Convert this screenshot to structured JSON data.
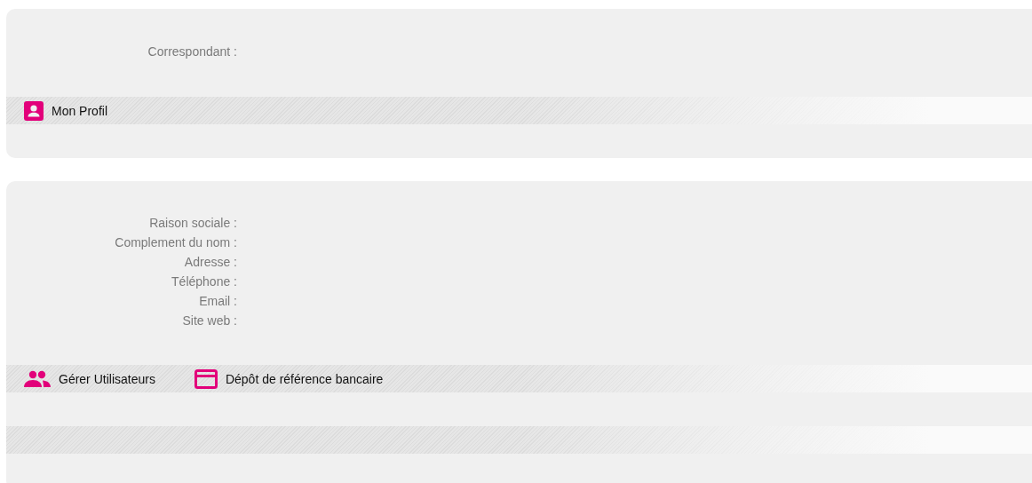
{
  "profile_panel": {
    "fields": [
      {
        "label": "Correspondant :"
      }
    ],
    "actions": [
      {
        "kind": "profile",
        "label": "Mon Profil"
      }
    ]
  },
  "company_panel": {
    "fields": [
      {
        "label": "Raison sociale :"
      },
      {
        "label": "Complement du nom :"
      },
      {
        "label": "Adresse :"
      },
      {
        "label": "Téléphone :"
      },
      {
        "label": "Email :"
      },
      {
        "label": "Site web :"
      }
    ],
    "actions": [
      {
        "kind": "users",
        "label": "Gérer Utilisateurs"
      },
      {
        "kind": "card",
        "label": "Dépôt de référence bancaire"
      }
    ]
  }
}
